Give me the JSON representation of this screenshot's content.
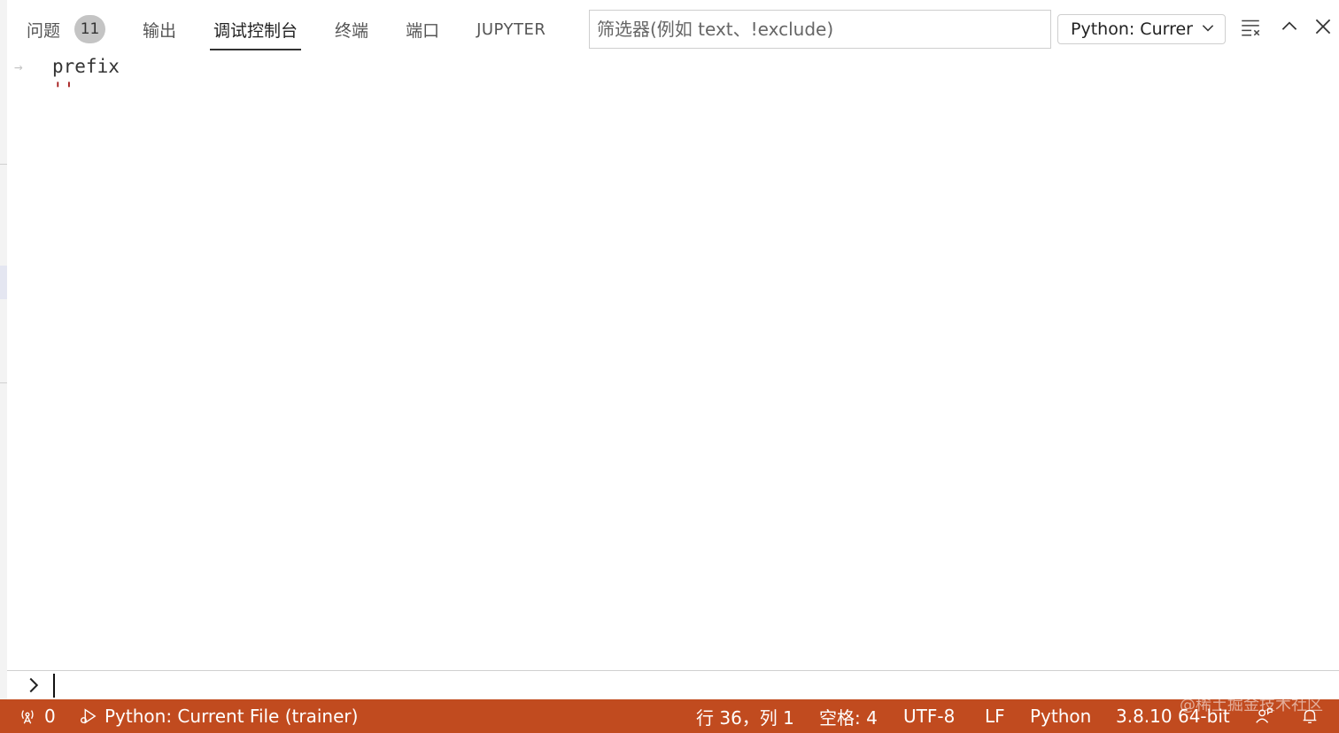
{
  "tabs": [
    {
      "label": "问题",
      "badge": "11"
    },
    {
      "label": "输出"
    },
    {
      "label": "调试控制台",
      "active": true
    },
    {
      "label": "终端"
    },
    {
      "label": "端口"
    },
    {
      "label": "JUPYTER"
    }
  ],
  "filter": {
    "placeholder": "筛选器(例如 text、!exclude)",
    "value": ""
  },
  "session_select": {
    "value": "Python: Currer"
  },
  "console": {
    "lines": [
      {
        "arrow": "→",
        "text": "prefix"
      },
      {
        "text": "''"
      }
    ],
    "input_value": ""
  },
  "statusbar": {
    "ports_count": "0",
    "debug_config": "Python: Current File (trainer)",
    "cursor_position": "行 36，列 1",
    "indent": "空格: 4",
    "encoding": "UTF-8",
    "eol": "LF",
    "language": "Python",
    "interpreter": "3.8.10 64-bit",
    "watermark": "@稀土掘金技术社区"
  },
  "colors": {
    "statusbar_bg": "#c14b1f",
    "string_literal": "#a31515",
    "badge_bg": "#c4c4c4"
  }
}
